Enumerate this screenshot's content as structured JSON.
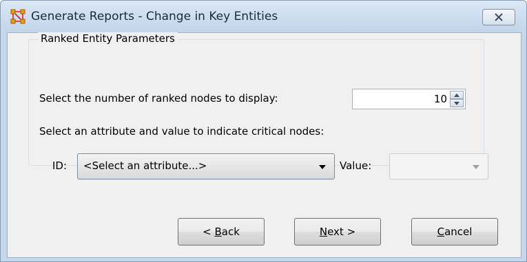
{
  "window": {
    "title": "Generate Reports - Change in Key Entities"
  },
  "group": {
    "title": "Ranked Entity Parameters",
    "ranked_label": "Select the number of ranked nodes to display:",
    "ranked_value": "10",
    "critical_label": "Select an attribute and value to indicate critical nodes:",
    "id_label": "ID:",
    "id_select_value": "<Select an attribute...>",
    "value_label": "Value:",
    "value_select_value": ""
  },
  "buttons": {
    "back": {
      "prefix": "< ",
      "mnemonic": "B",
      "rest": "ack"
    },
    "next": {
      "mnemonic": "N",
      "rest": "ext >"
    },
    "cancel": {
      "mnemonic": "C",
      "rest": "ancel"
    }
  },
  "icons": {
    "app": "network-nodes-icon",
    "close": "close-icon",
    "spin_up": "spin-up-icon",
    "spin_down": "spin-down-icon",
    "dropdown": "chevron-down-icon"
  },
  "colors": {
    "title_bar": "#cbdcee",
    "client_bg": "#f0f0f0",
    "app_icon": "#e8a000"
  }
}
